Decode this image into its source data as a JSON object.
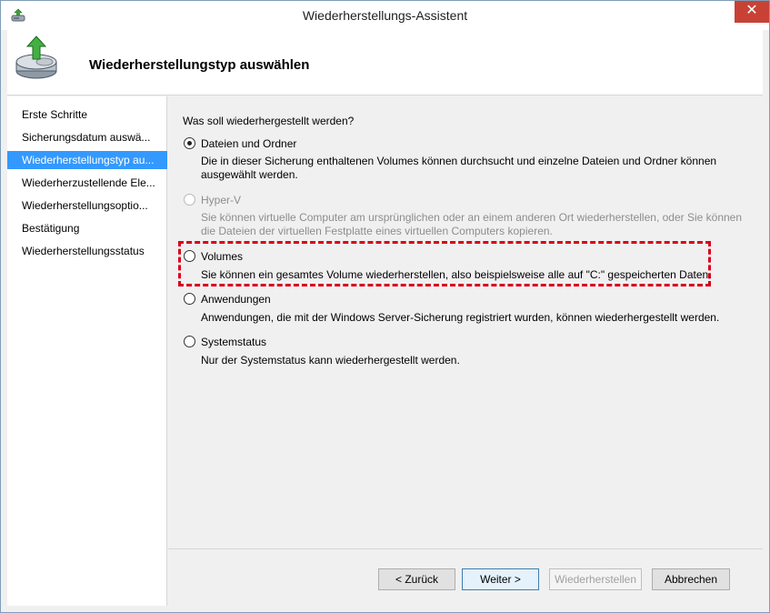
{
  "window": {
    "title": "Wiederherstellungs-Assistent",
    "close_glyph": "✕"
  },
  "header": {
    "title": "Wiederherstellungstyp auswählen"
  },
  "sidebar": {
    "items": [
      {
        "label": "Erste Schritte"
      },
      {
        "label": "Sicherungsdatum auswä..."
      },
      {
        "label": "Wiederherstellungstyp au..."
      },
      {
        "label": "Wiederherzustellende Ele..."
      },
      {
        "label": "Wiederherstellungsoptio..."
      },
      {
        "label": "Bestätigung"
      },
      {
        "label": "Wiederherstellungsstatus"
      }
    ],
    "selected_index": 2
  },
  "content": {
    "question": "Was soll wiederhergestellt werden?",
    "options": [
      {
        "label": "Dateien und Ordner",
        "description": "Die in dieser Sicherung enthaltenen Volumes können durchsucht und einzelne Dateien und Ordner können ausgewählt werden.",
        "checked": true,
        "enabled": true
      },
      {
        "label": "Hyper-V",
        "description": "Sie können virtuelle Computer am ursprünglichen oder an einem anderen Ort wiederherstellen, oder Sie können die Dateien der virtuellen Festplatte eines virtuellen Computers kopieren.",
        "checked": false,
        "enabled": false
      },
      {
        "label": "Volumes",
        "description": "Sie können ein gesamtes Volume wiederherstellen, also beispielsweise alle auf \"C:\" gespeicherten Daten.",
        "checked": false,
        "enabled": true
      },
      {
        "label": "Anwendungen",
        "description": "Anwendungen, die mit der Windows Server-Sicherung registriert wurden, können wiederhergestellt werden.",
        "checked": false,
        "enabled": true
      },
      {
        "label": "Systemstatus",
        "description": "Nur der Systemstatus kann wiederhergestellt werden.",
        "checked": false,
        "enabled": true
      }
    ]
  },
  "footer": {
    "back_label": "< Zurück",
    "next_label": "Weiter >",
    "restore_label": "Wiederherstellen",
    "cancel_label": "Abbrechen"
  },
  "colors": {
    "selection": "#3399ff",
    "highlight_border": "#d9001b",
    "close_button": "#c74235"
  },
  "icons": {
    "title": "backup-restore-icon",
    "header": "disk-restore-arrow-icon"
  }
}
